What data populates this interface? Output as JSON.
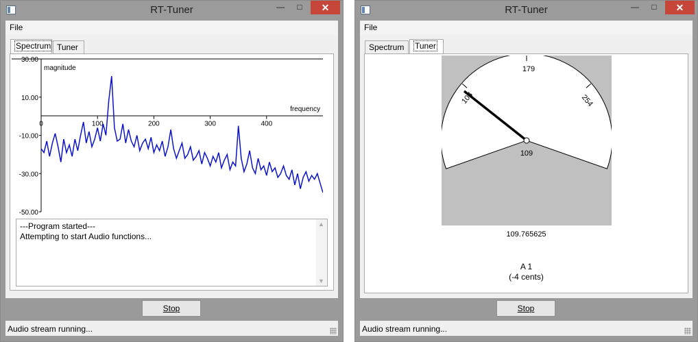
{
  "left_window": {
    "title": "RT-Tuner",
    "menu": {
      "file": "File"
    },
    "tabs": [
      {
        "label": "Spectrum",
        "active": true
      },
      {
        "label": "Tuner",
        "active": false
      }
    ],
    "stop_label": "Stop",
    "status": "Audio stream running...",
    "log_lines": [
      "---Program started---",
      "Attempting to start Audio functions..."
    ]
  },
  "right_window": {
    "title": "RT-Tuner",
    "menu": {
      "file": "File"
    },
    "tabs": [
      {
        "label": "Spectrum",
        "active": false
      },
      {
        "label": "Tuner",
        "active": true
      }
    ],
    "stop_label": "Stop",
    "status": "Audio stream running...",
    "tuner": {
      "gauge_labels": {
        "low": "104",
        "center": "179",
        "high": "254",
        "current": "109"
      },
      "needle_value": 109,
      "frequency": "109.765625",
      "note": "A 1",
      "cents": "(-4 cents)"
    }
  },
  "chart_data": {
    "type": "line",
    "xlabel": "frequency",
    "ylabel": "magnitude",
    "xlim": [
      0,
      500
    ],
    "ylim": [
      -50,
      30
    ],
    "xticks": [
      "0",
      "100",
      "200",
      "300",
      "400"
    ],
    "yticks": [
      "30.00",
      "10.00",
      "-10.00",
      "-30.00",
      "-50.00"
    ],
    "color": "#0b13c8",
    "series": [
      {
        "x": [
          0,
          5,
          10,
          15,
          20,
          25,
          30,
          35,
          40,
          45,
          50,
          55,
          60,
          65,
          70,
          75,
          80,
          85,
          90,
          95,
          100,
          105,
          110,
          115,
          120,
          125,
          130,
          135,
          140,
          145,
          150,
          155,
          160,
          165,
          170,
          175,
          180,
          185,
          190,
          195,
          200,
          205,
          210,
          215,
          220,
          225,
          230,
          235,
          240,
          245,
          250,
          255,
          260,
          265,
          270,
          275,
          280,
          285,
          290,
          295,
          300,
          305,
          310,
          315,
          320,
          325,
          330,
          335,
          340,
          345,
          350,
          355,
          360,
          365,
          370,
          375,
          380,
          385,
          390,
          395,
          400,
          405,
          410,
          415,
          420,
          425,
          430,
          435,
          440,
          445,
          450,
          455,
          460,
          465,
          470,
          475,
          480,
          485,
          490,
          495,
          500
        ],
        "values": [
          -17,
          -19,
          -13,
          -21,
          -14,
          -9,
          -16,
          -24,
          -12,
          -19,
          -15,
          -21,
          -12,
          -18,
          -10,
          -3,
          -14,
          -8,
          -16,
          -12,
          -6,
          -13,
          -4,
          -10,
          8,
          21,
          -6,
          -13,
          -12,
          -4,
          -14,
          -7,
          -13,
          -16,
          -10,
          -18,
          -14,
          -12,
          -17,
          -11,
          -19,
          -15,
          -18,
          -13,
          -21,
          -16,
          -7,
          -17,
          -22,
          -18,
          -14,
          -22,
          -20,
          -16,
          -23,
          -21,
          -18,
          -25,
          -19,
          -22,
          -26,
          -21,
          -24,
          -19,
          -27,
          -23,
          -20,
          -28,
          -24,
          -26,
          -5,
          -22,
          -29,
          -25,
          -18,
          -27,
          -30,
          -22,
          -28,
          -26,
          -31,
          -24,
          -29,
          -27,
          -32,
          -30,
          -26,
          -31,
          -33,
          -28,
          -36,
          -30,
          -38,
          -32,
          -29,
          -34,
          -31,
          -33,
          -30,
          -35,
          -40
        ]
      }
    ]
  }
}
